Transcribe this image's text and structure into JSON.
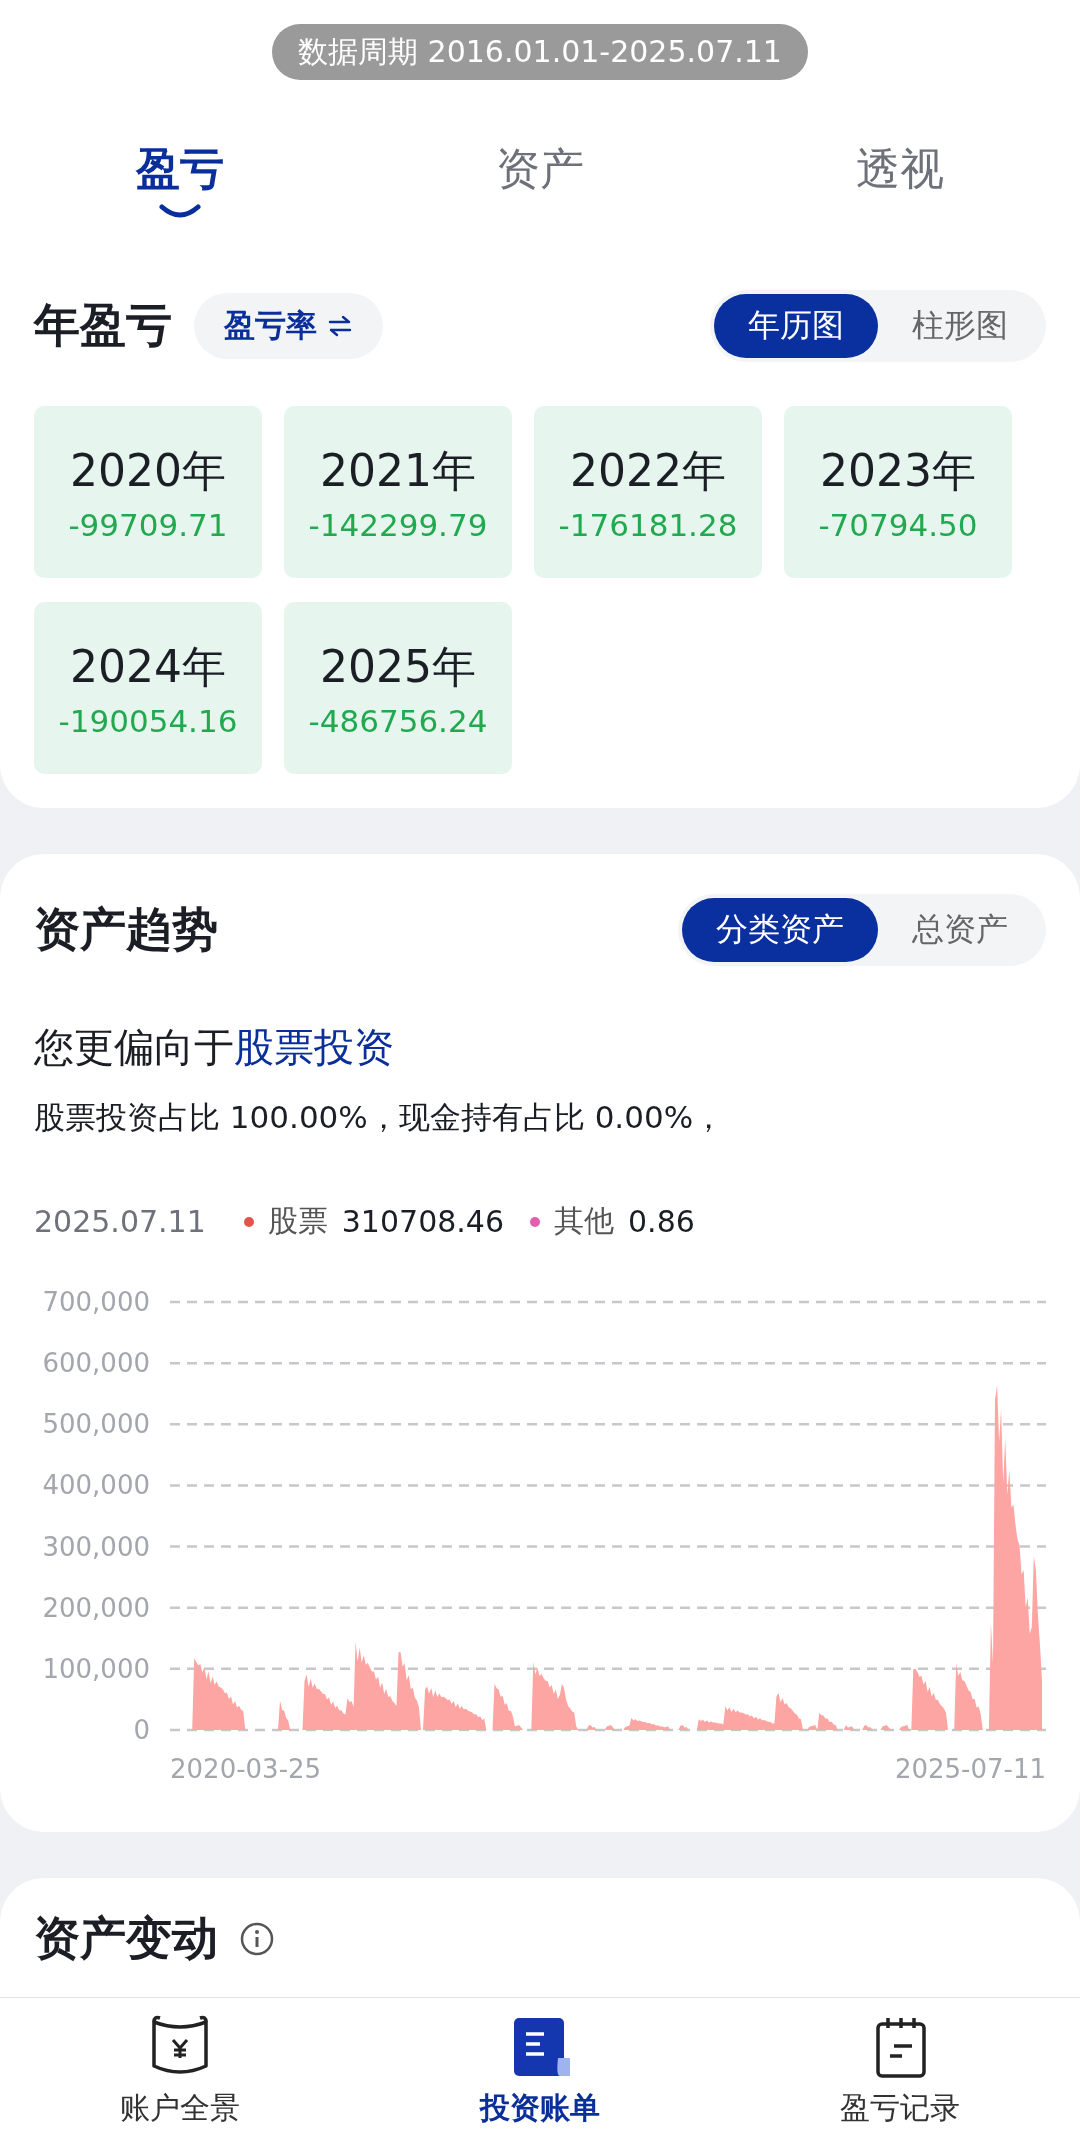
{
  "period_badge": "数据周期 2016.01.01-2025.07.11",
  "tabs": [
    {
      "label": "盈亏",
      "selected": true
    },
    {
      "label": "资产",
      "selected": false
    },
    {
      "label": "透视",
      "selected": false
    }
  ],
  "annual_pnl": {
    "title": "年盈亏",
    "rate_chip": "盈亏率",
    "views": [
      {
        "label": "年历图",
        "selected": true
      },
      {
        "label": "柱形图",
        "selected": false
      }
    ],
    "years": [
      {
        "year": "2020年",
        "value": "-99709.71"
      },
      {
        "year": "2021年",
        "value": "-142299.79"
      },
      {
        "year": "2022年",
        "value": "-176181.28"
      },
      {
        "year": "2023年",
        "value": "-70794.50"
      },
      {
        "year": "2024年",
        "value": "-190054.16"
      },
      {
        "year": "2025年",
        "value": "-486756.24"
      }
    ]
  },
  "asset_trend": {
    "title": "资产趋势",
    "views": [
      {
        "label": "分类资产",
        "selected": true
      },
      {
        "label": "总资产",
        "selected": false
      }
    ],
    "preference": "您更偏向于**股票投资**",
    "ratio_text": "股票投资占比 100.00%，现金持有占比 0.00%，",
    "legend_date": "2025.07.11",
    "legend": [
      {
        "name": "股票",
        "value": "310708.46",
        "color": "#e5534b"
      },
      {
        "name": "其他",
        "value": "0.86",
        "color": "#e05fb0"
      }
    ],
    "chart": {
      "y_labels": [
        "700,000",
        "600,000",
        "500,000",
        "400,000",
        "300,000",
        "200,000",
        "100,000",
        "0"
      ],
      "x_labels": [
        "2020-03-25",
        "2025-07-11"
      ]
    }
  },
  "asset_change": {
    "title": "资产变动"
  },
  "bottom_nav": [
    {
      "label": "账户全景",
      "selected": false
    },
    {
      "label": "投资账单",
      "selected": true
    },
    {
      "label": "盈亏记录",
      "selected": false
    }
  ]
}
